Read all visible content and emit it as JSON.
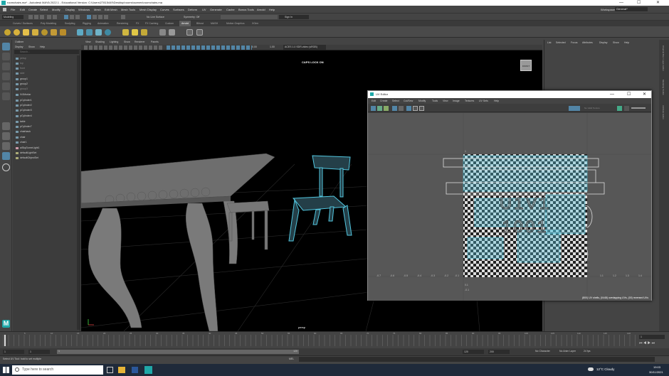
{
  "window": {
    "title": "roomchairs.ma* - Autodesk MAYA 2022.1 - Educational Version: C:\\Users\\27815449\\Desktop\\rooms\\scenes\\roomchairs.ma",
    "min_glyph": "—",
    "max_glyph": "☐",
    "close_glyph": "✕"
  },
  "menubar": {
    "items": [
      "File",
      "Edit",
      "Create",
      "Select",
      "Modify",
      "Display",
      "Windows",
      "Mesh",
      "Edit Mesh",
      "Mesh Tools",
      "Mesh Display",
      "Curves",
      "Surfaces",
      "Deform",
      "UV",
      "Generate",
      "Cache",
      "Bonus Tools",
      "Arnold",
      "Help"
    ],
    "workspace_label": "Workspace:",
    "workspace_value": "General*"
  },
  "statusline": {
    "mode": "Modeling",
    "no_live": "No Live Surface",
    "symmetry": "Symmetry: Off",
    "sign_in": "Sign In"
  },
  "shelf_tabs": [
    "Curves / Surfaces",
    "Poly Modeling",
    "Sculpting",
    "Rigging",
    "Animation",
    "Rendering",
    "FX",
    "FX Caching",
    "Custom",
    "Arnold",
    "Bifrost",
    "MASH",
    "Motion Graphics",
    "XGen"
  ],
  "outliner": {
    "title": "Outliner",
    "menu": [
      "Display",
      "Show",
      "Help"
    ],
    "search_placeholder": "Search...",
    "items": [
      "persp",
      "top",
      "front",
      "side",
      "group1",
      "group2",
      "group3",
      "IV4Mortar",
      "pCylinder1",
      "pCylinder2",
      "pCylinder3",
      "pCylinder4",
      "table",
      "pCylinder7",
      "chairback",
      "chair",
      "chair1",
      "aiSkyDomeLight1",
      "defaultLightSet",
      "defaultObjectSet"
    ]
  },
  "viewport": {
    "menu": [
      "View",
      "Shading",
      "Lighting",
      "Show",
      "Renderer",
      "Panels"
    ],
    "exposure": "0.00",
    "gamma": "1.00",
    "color_space": "ACES 1.0 SDR-video (sRGB)",
    "caps_lock": "CAPS LOCK ON",
    "camera": "persp",
    "view_cube": "FRONT"
  },
  "channelbox": {
    "menu": [
      "List",
      "Selected",
      "Focus",
      "Attributes",
      "Display",
      "Show",
      "Help"
    ]
  },
  "side_tabs": [
    "Channel Box / Layer Editor",
    "Modeling Toolkit",
    "Attribute Editor"
  ],
  "uv_editor": {
    "title": "UV Editor",
    "menu": [
      "Edit",
      "Create",
      "Select",
      "Cut/Sew",
      "Modify",
      "Tools",
      "View",
      "Image",
      "Textures",
      "UV Sets",
      "Help"
    ],
    "texture_dropdown": "No Valid Texture",
    "tile_label_top": "U1V1",
    "tile_label_bottom": "1001",
    "status": "(800) UV shells, (0448) overlapping UVs, (00) reversed UVs",
    "axis_v": [
      "1",
      "0.9",
      "0.1",
      "-0.1"
    ],
    "axis_u": [
      "-0.7",
      "-0.6",
      "-0.5",
      "-0.4",
      "-0.3",
      "-0.2",
      "-0.1",
      "1.1",
      "1.2",
      "1.3",
      "1.4"
    ]
  },
  "timeline": {
    "ticks": [
      "5",
      "10",
      "15",
      "20",
      "25",
      "30",
      "35",
      "40",
      "45",
      "50",
      "55",
      "60",
      "65",
      "70",
      "75",
      "80",
      "85",
      "90",
      "95",
      "100",
      "105",
      "110",
      "115",
      "120"
    ],
    "current_frame": "1",
    "start": "1",
    "range_start": "1",
    "range_end": "120",
    "end": "120",
    "anim_end": "200",
    "character": "No Character",
    "anim_layer": "No Anim Layer",
    "fps": "24 fps"
  },
  "cmdline": {
    "help": "Select UV Tool: hold to set multiple",
    "lang": "MEL"
  },
  "taskbar": {
    "search_placeholder": "Type here to search",
    "weather": "12°C Cloudy",
    "time": "19:03",
    "date": "30/11/2021"
  },
  "colors": {
    "accent_blue": "#5285a6",
    "active_tab": "#5d5d5d",
    "wireframe": "#52c7e0",
    "maya_logo": "#1fa8a8"
  }
}
